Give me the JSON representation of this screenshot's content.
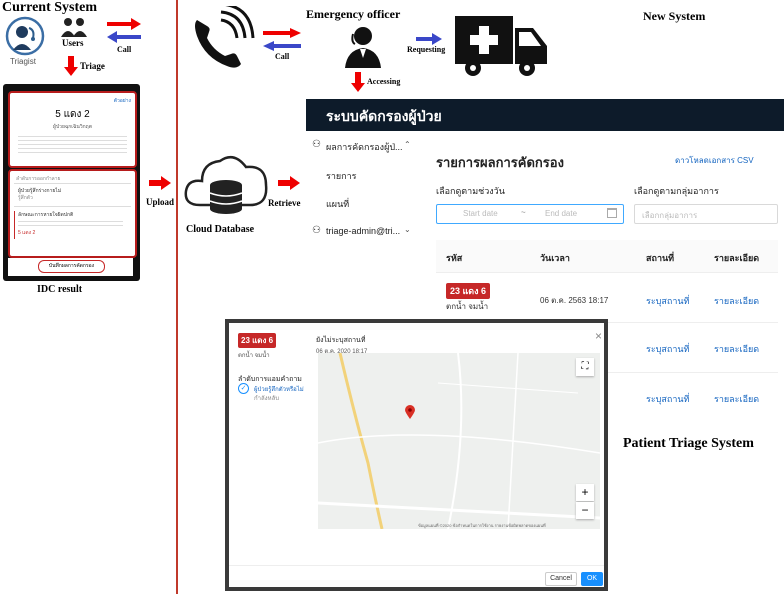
{
  "left": {
    "title": "Current System",
    "triagist_label": "Triagist",
    "users_label": "Users",
    "call_label": "Call",
    "triage_label": "Triage",
    "idc_result_label": "IDC result",
    "phone_card": {
      "top_link": "ตัวอย่าง",
      "score": "5 แดง 2",
      "subtitle": "ผู้ป่วยฉุกเฉินวิกฤต",
      "section_title": "ลำดับการออกกำลาย",
      "item1": "ผู้ป่วยรู้สึกร่างกายไม่",
      "item1b": "รู้สึกตัว",
      "item2": "ลักษณะการหายใจผิดปกติ",
      "item2b": "5 แดง 2",
      "save_button": "บันทึกผลการคัดกรอง"
    }
  },
  "middle": {
    "upload_label": "Upload",
    "cloud_label": "Cloud Database",
    "retrieve_label": "Retrieve",
    "call_label": "Call",
    "emergency_officer": "Emergency officer",
    "accessing_label": "Accessing",
    "requesting_label": "Requesting"
  },
  "right": {
    "new_system": "New System",
    "patient_triage_system": "Patient Triage System"
  },
  "web": {
    "app_title": "ระบบคัดกรองผู้ป่วย",
    "sidebar": {
      "group": "ผลการคัดกรองผู้ป่...",
      "item1": "รายการ",
      "item2": "แผนที่",
      "user": "triage-admin@tri..."
    },
    "page_title": "รายการผลการคัดกรอง",
    "download_csv": "ดาวโหลดเอกสาร CSV",
    "filter_date_label": "เลือกดูตามช่วงวัน",
    "start_date_placeholder": "Start date",
    "end_date_placeholder": "End date",
    "filter_group_label": "เลือกดูตามกลุ่มอาการ",
    "group_placeholder": "เลือกกลุ่มอาการ",
    "columns": [
      "รหัส",
      "วันเวลา",
      "สถานที่",
      "รายละเอียด"
    ],
    "row1": {
      "badge": "23 แดง 6",
      "name": "ตกน้ำ จมน้ำ",
      "datetime": "06 ต.ค. 2563 18:17",
      "location": "ระบุสถานที่",
      "detail": "รายละเอียด"
    },
    "row2": {
      "location": "ระบุสถานที่",
      "detail": "รายละเอียด"
    },
    "row3": {
      "location": "ระบุสถานที่",
      "detail": "รายละเอียด"
    }
  },
  "modal": {
    "badge": "23 แดง 6",
    "name": "ตกน้ำ จมน้ำ",
    "location_title": "ยังไม่ระบุสถานที่",
    "datetime": "06 ต.ค. 2020 18:17",
    "section_title": "ลำดับการแอมคำถาม",
    "item1": "ผู้ป่วยรู้สึกตัวหรือไม่",
    "item1b": "กำลังหลับ",
    "close": "×",
    "zoom_in": "+",
    "zoom_out": "−",
    "fullscreen": "⛶",
    "map_attribution": "ข้อมูลแผนที่ ©2020  ข้อกำหนดในการใช้งาน  รายงานข้อผิดพลาดของแผนที่",
    "cancel": "Cancel",
    "ok": "OK"
  },
  "colors": {
    "arrow_red": "#e00000",
    "arrow_blue": "#3a47c8",
    "navy": "#0d1b2a",
    "badge_red": "#c62828",
    "link_blue": "#1565c0",
    "primary_btn": "#1890ff"
  }
}
